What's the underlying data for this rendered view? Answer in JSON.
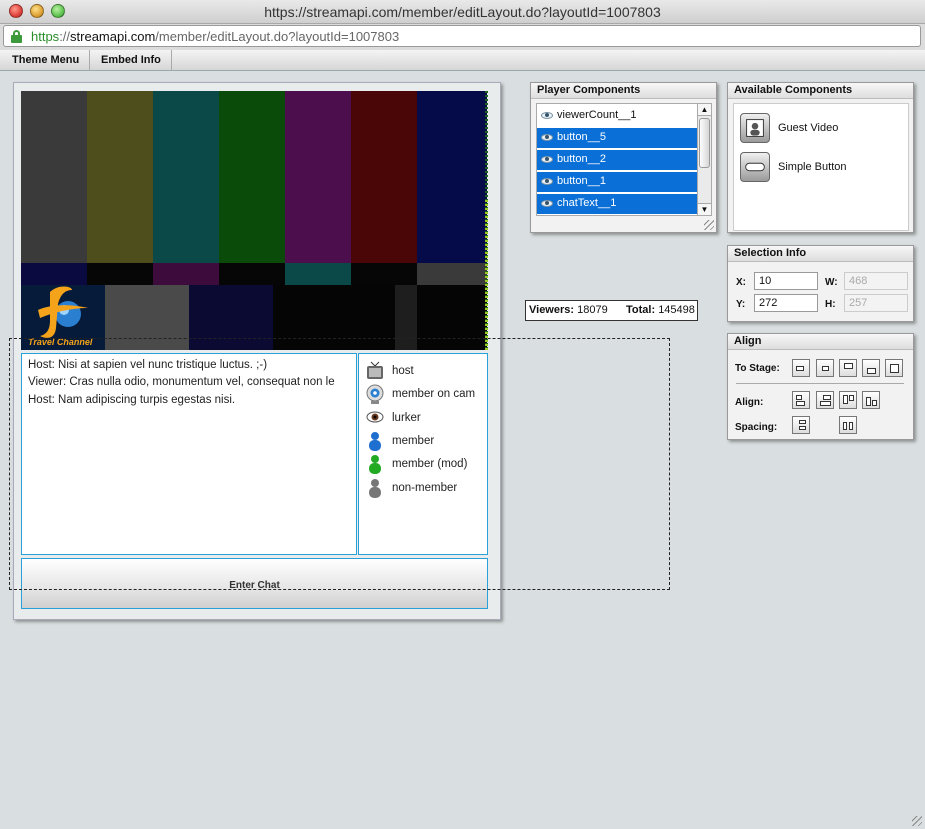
{
  "window": {
    "title": "https://streamapi.com/member/editLayout.do?layoutId=1007803"
  },
  "address_bar": {
    "scheme": "https",
    "separator": "://",
    "host": "streamapi.com",
    "path": "/member/editLayout.do?layoutId=1007803"
  },
  "menu": {
    "items": [
      "Theme Menu",
      "Embed Info"
    ]
  },
  "stage": {
    "logo_text": "Travel Channel",
    "chat_lines": [
      "Host: Nisi at sapien vel nunc tristique luctus. ;-)",
      "Viewer: Cras nulla odio, monumentum vel, consequat non le",
      "Host: Nam adipiscing turpis egestas nisi."
    ],
    "user_types": [
      {
        "label": "host",
        "icon": "tv-icon"
      },
      {
        "label": "member on cam",
        "icon": "webcam-icon"
      },
      {
        "label": "lurker",
        "icon": "eye-icon"
      },
      {
        "label": "member",
        "icon": "member-blue-icon"
      },
      {
        "label": "member (mod)",
        "icon": "member-green-icon"
      },
      {
        "label": "non-member",
        "icon": "member-gray-icon"
      }
    ],
    "enter_chat_label": "Enter Chat",
    "viewers_label": "Viewers:",
    "viewers_value": "18079",
    "total_label": "Total:",
    "total_value": "145498"
  },
  "player_components": {
    "title": "Player Components",
    "items": [
      {
        "label": "viewerCount__1",
        "selected": false
      },
      {
        "label": "button__5",
        "selected": true
      },
      {
        "label": "button__2",
        "selected": true
      },
      {
        "label": "button__1",
        "selected": true
      },
      {
        "label": "chatText__1",
        "selected": true
      }
    ]
  },
  "available_components": {
    "title": "Available Components",
    "items": [
      {
        "label": "Guest Video",
        "icon": "guest-video-icon"
      },
      {
        "label": "Simple Button",
        "icon": "simple-button-icon"
      }
    ]
  },
  "selection_info": {
    "title": "Selection Info",
    "x_label": "X:",
    "x_value": "10",
    "y_label": "Y:",
    "y_value": "272",
    "w_label": "W:",
    "w_value": "468",
    "h_label": "H:",
    "h_value": "257"
  },
  "align": {
    "title": "Align",
    "to_stage_label": "To Stage:",
    "align_label": "Align:",
    "spacing_label": "Spacing:"
  },
  "colors": {
    "accent": "#0a6fd6",
    "selection_border": "#2aa0d8",
    "background": "#d9dfe0",
    "test_pattern_top": [
      "#3a3a3a",
      "#4e4e1c",
      "#0b4848",
      "#0a4b0a",
      "#4c0e4c",
      "#4a0606",
      "#050a48"
    ]
  }
}
